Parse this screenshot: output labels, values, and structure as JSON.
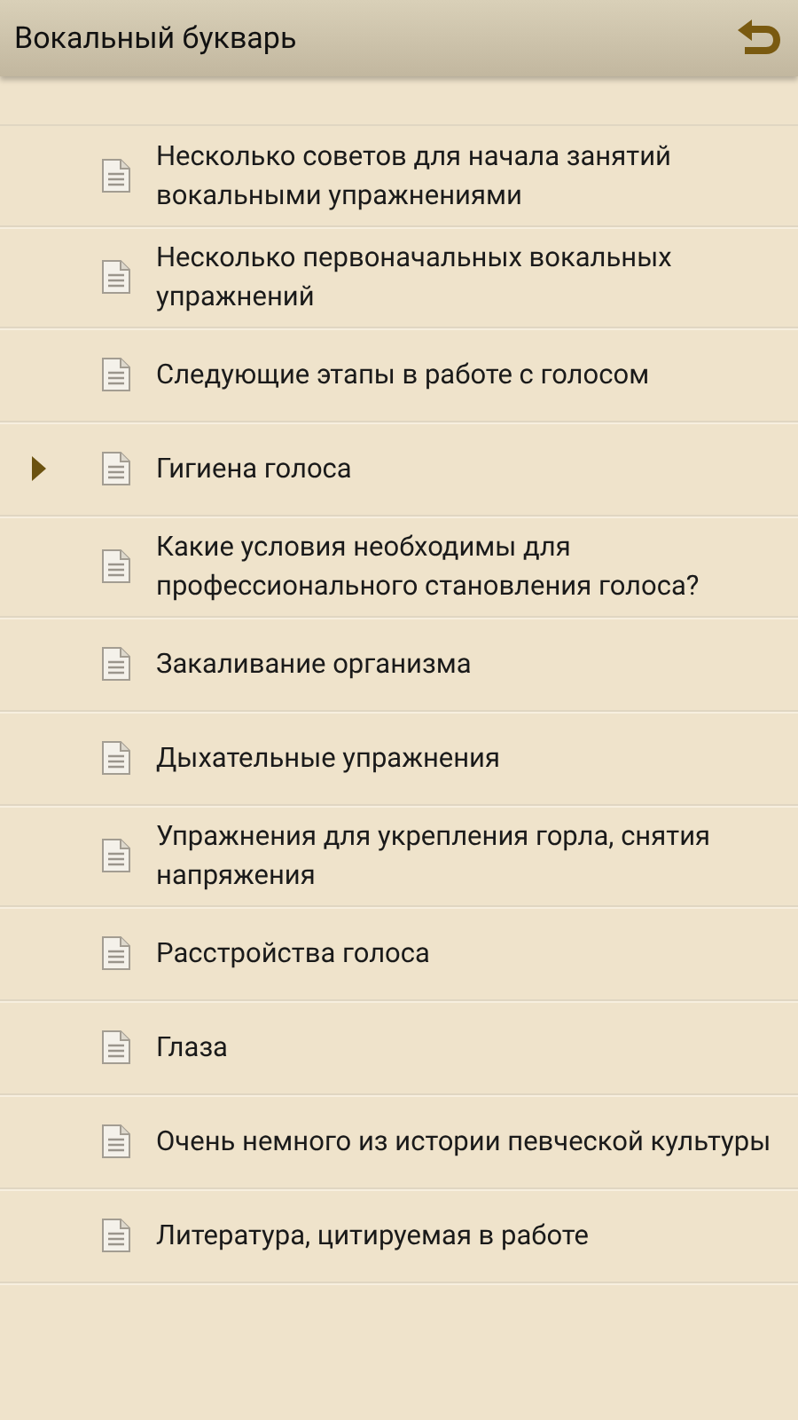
{
  "header": {
    "title": "Вокальный букварь"
  },
  "items": [
    {
      "title": "Несколько советов для начала занятий вокальными упражнениями",
      "selected": false
    },
    {
      "title": "Несколько первоначальных вокальных упражнений",
      "selected": false
    },
    {
      "title": "Следующие этапы в работе с голосом",
      "selected": false
    },
    {
      "title": "Гигиена голоса",
      "selected": true
    },
    {
      "title": "Какие условия необходимы для профессионального становления голоса?",
      "selected": false
    },
    {
      "title": "Закаливание организма",
      "selected": false
    },
    {
      "title": "Дыхательные упражнения",
      "selected": false
    },
    {
      "title": "Упражнения для укрепления горла, снятия напряжения",
      "selected": false
    },
    {
      "title": "Расстройства голоса",
      "selected": false
    },
    {
      "title": "Глаза",
      "selected": false
    },
    {
      "title": "Очень немного из истории певческой культуры",
      "selected": false
    },
    {
      "title": "Литература, цитируемая в работе",
      "selected": false
    }
  ]
}
